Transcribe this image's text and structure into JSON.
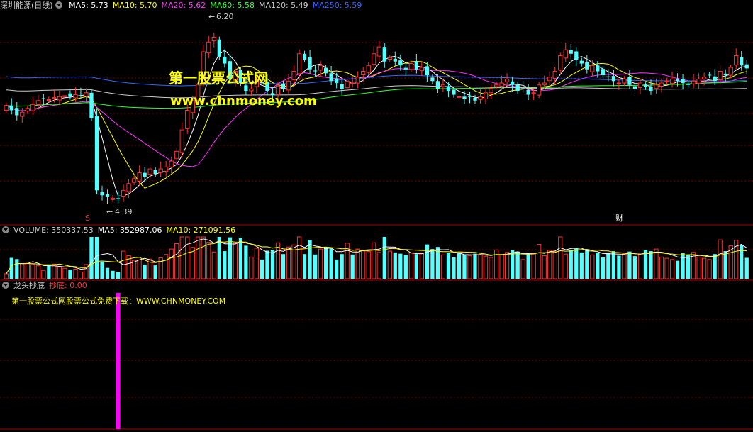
{
  "price_panel": {
    "title": "深圳能源(日线)",
    "ma_legend": [
      {
        "label": "MA5: 5.73",
        "color": "#ffffff"
      },
      {
        "label": "MA10: 5.70",
        "color": "#ffff00"
      },
      {
        "label": "MA20: 5.62",
        "color": "#ff33ff"
      },
      {
        "label": "MA60: 5.58",
        "color": "#33ff33"
      },
      {
        "label": "MA120: 5.49",
        "color": "#cccccc"
      },
      {
        "label": "MA250: 5.59",
        "color": "#3366ff"
      }
    ],
    "high_label": "6.20",
    "low_label": "4.39",
    "marker_left": "S",
    "marker_right": "财"
  },
  "volume_panel": {
    "legend": [
      {
        "label": "VOLUME: 350337.53",
        "color": "#cccccc"
      },
      {
        "label": "MA5: 352987.06",
        "color": "#ffffff"
      },
      {
        "label": "MA10: 271091.56",
        "color": "#ffff00"
      }
    ]
  },
  "indicator_panel": {
    "title": "龙头抄底",
    "value_label": "抄底: 0.00",
    "subtitle": "第一股票公式网股票公式免费下载：WWW.CHNMONEY.COM"
  },
  "watermark": {
    "line1": "第一股票公式网",
    "line2": "www.chnmoney.com"
  },
  "colors": {
    "up": "#ff3333",
    "down": "#54ffff",
    "grid": "#7a0000",
    "signal": "#ff00ff"
  },
  "chart_data": [
    {
      "type": "candlestick",
      "title": "深圳能源(日线)",
      "ylim": [
        4.25,
        6.3
      ],
      "annotations": {
        "high": 6.2,
        "low": 4.39
      },
      "series": [
        {
          "name": "MA5",
          "value": 5.73
        },
        {
          "name": "MA10",
          "value": 5.7
        },
        {
          "name": "MA20",
          "value": 5.62
        },
        {
          "name": "MA60",
          "value": 5.58
        },
        {
          "name": "MA120",
          "value": 5.49
        },
        {
          "name": "MA250",
          "value": 5.59
        }
      ],
      "ohlc_close": [
        5.35,
        5.3,
        5.25,
        5.28,
        5.32,
        5.36,
        5.4,
        5.42,
        5.41,
        5.43,
        5.44,
        5.45,
        5.44,
        5.46,
        5.47,
        5.48,
        5.22,
        4.48,
        4.43,
        4.41,
        4.4,
        4.39,
        4.48,
        4.55,
        4.6,
        4.66,
        4.62,
        4.7,
        4.65,
        4.7,
        4.72,
        4.78,
        4.88,
        5.1,
        5.3,
        5.4,
        5.56,
        5.9,
        6.0,
        6.05,
        5.85,
        5.78,
        5.62,
        5.7,
        5.58,
        5.5,
        5.52,
        5.6,
        5.58,
        5.5,
        5.46,
        5.55,
        5.52,
        5.6,
        5.7,
        5.88,
        5.82,
        5.72,
        5.7,
        5.76,
        5.68,
        5.6,
        5.58,
        5.52,
        5.6,
        5.58,
        5.64,
        5.7,
        5.76,
        5.88,
        5.95,
        5.8,
        5.84,
        5.8,
        5.76,
        5.72,
        5.78,
        5.72,
        5.74,
        5.66,
        5.6,
        5.52,
        5.56,
        5.5,
        5.46,
        5.44,
        5.42,
        5.44,
        5.4,
        5.44,
        5.48,
        5.52,
        5.56,
        5.58,
        5.62,
        5.56,
        5.5,
        5.52,
        5.46,
        5.48,
        5.56,
        5.58,
        5.64,
        5.7,
        5.86,
        5.92,
        5.88,
        5.82,
        5.78,
        5.72,
        5.76,
        5.7,
        5.66,
        5.64,
        5.6,
        5.58,
        5.62,
        5.56,
        5.52,
        5.58,
        5.54,
        5.5,
        5.56,
        5.58,
        5.6,
        5.62,
        5.6,
        5.58,
        5.56,
        5.6,
        5.62,
        5.64,
        5.66,
        5.6,
        5.7,
        5.66,
        5.74,
        5.86,
        5.76,
        5.73
      ]
    },
    {
      "type": "bar",
      "title": "VOLUME",
      "series": [
        {
          "name": "VOLUME",
          "value": 350337.53
        },
        {
          "name": "MA5",
          "value": 352987.06
        },
        {
          "name": "MA10",
          "value": 271091.56
        }
      ]
    },
    {
      "type": "bar",
      "title": "龙头抄底",
      "series": [
        {
          "name": "抄底",
          "value": 0.0
        }
      ]
    }
  ]
}
